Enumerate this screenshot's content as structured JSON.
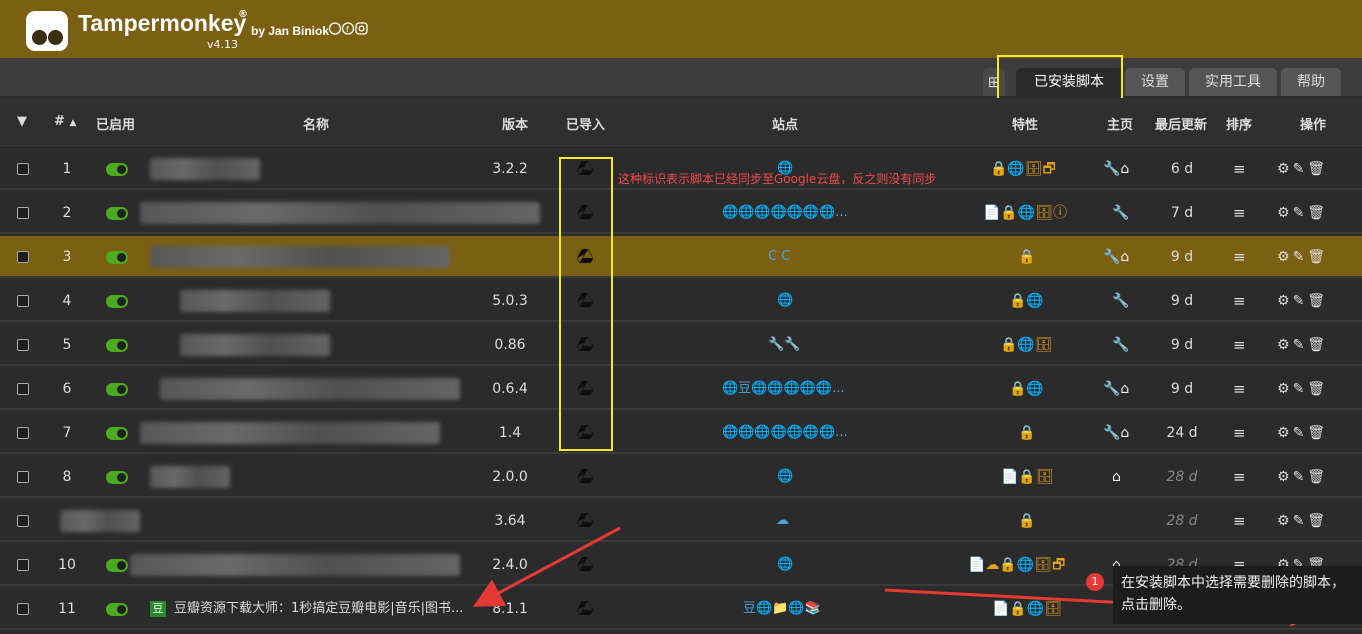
{
  "header": {
    "app_title": "Tampermonkey",
    "registered": "®",
    "byline": "by Jan Biniok",
    "version": "v4.13",
    "social": "",
    "colors": {
      "header_bg": "#7b5f13",
      "selected_row": "#7b5f13",
      "toggle_on": "#4caa1f"
    }
  },
  "tabs": {
    "add": "⊞",
    "installed": "已安装脚本",
    "settings": "设置",
    "utilities": "实用工具",
    "help": "帮助"
  },
  "table": {
    "headers": {
      "filter": "▼",
      "num": "#",
      "enabled": "已启用",
      "name": "名称",
      "version": "版本",
      "imported": "已导入",
      "sites": "站点",
      "features": "特性",
      "homepage": "主页",
      "last_updated": "最后更新",
      "sort": "排序",
      "actions": "操作"
    },
    "rows": [
      {
        "num": "1",
        "name": "",
        "version": "3.2.2",
        "sites": "🌐",
        "features": "🔒🌐🗄🗗",
        "home": "🔧⌂",
        "updated": "6 d"
      },
      {
        "num": "2",
        "name": "",
        "version": "",
        "sites": "🌐🌐🌐🌐🌐🌐🌐...",
        "features": "📄🔒🌐🗄ⓘ",
        "home": "🔧",
        "updated": "7 d"
      },
      {
        "num": "3",
        "name": "",
        "version": "",
        "sites": "C C",
        "features": "🔒",
        "home": "🔧⌂",
        "updated": "9 d"
      },
      {
        "num": "4",
        "name": "",
        "version": "5.0.3",
        "sites": "🌐",
        "features": "🔒🌐",
        "home": "🔧",
        "updated": "9 d"
      },
      {
        "num": "5",
        "name": "",
        "version": "0.86",
        "sites": "🔧🔧",
        "features": "🔒🌐🗄",
        "home": "🔧",
        "updated": "9 d"
      },
      {
        "num": "6",
        "name": "",
        "version": "0.6.4",
        "sites": "🌐豆🌐🌐🌐🌐🌐...",
        "features": "🔒🌐",
        "home": "🔧⌂",
        "updated": "9 d"
      },
      {
        "num": "7",
        "name": "",
        "version": "1.4",
        "sites": "🌐🌐🌐🌐🌐🌐🌐...",
        "features": "🔒",
        "home": "🔧⌂",
        "updated": "24 d"
      },
      {
        "num": "8",
        "name": "",
        "version": "2.0.0",
        "sites": "🌐",
        "features": "📄🔒🗄",
        "home": "⌂",
        "updated": "28 d"
      },
      {
        "num": "9",
        "name": "",
        "version": "3.64",
        "sites": "☁",
        "features": "🔒",
        "home": "",
        "updated": "28 d"
      },
      {
        "num": "10",
        "name": "",
        "version": "2.4.0",
        "sites": "🌐",
        "features": "📄☁🔒🌐🗄🗗",
        "home": "⌂",
        "updated": "28 d"
      },
      {
        "num": "11",
        "name": "豆瓣资源下载大师：1秒搞定豆瓣电影|音乐|图书...",
        "version": "8.1.1",
        "sites": "豆🌐📁🌐📚",
        "features": "📄🔒🌐🗄",
        "home": "",
        "updated": ""
      }
    ],
    "sort_glyph": "≡",
    "actions_glyph": "⚙✎🗑"
  },
  "annotations": {
    "drive_note": "这种标识表示脚本已经同步至Google云盘，反之则没有同步",
    "delete_badge": "1",
    "delete_tip": "在安装脚本中选择需要删除的脚本，点击删除。"
  }
}
